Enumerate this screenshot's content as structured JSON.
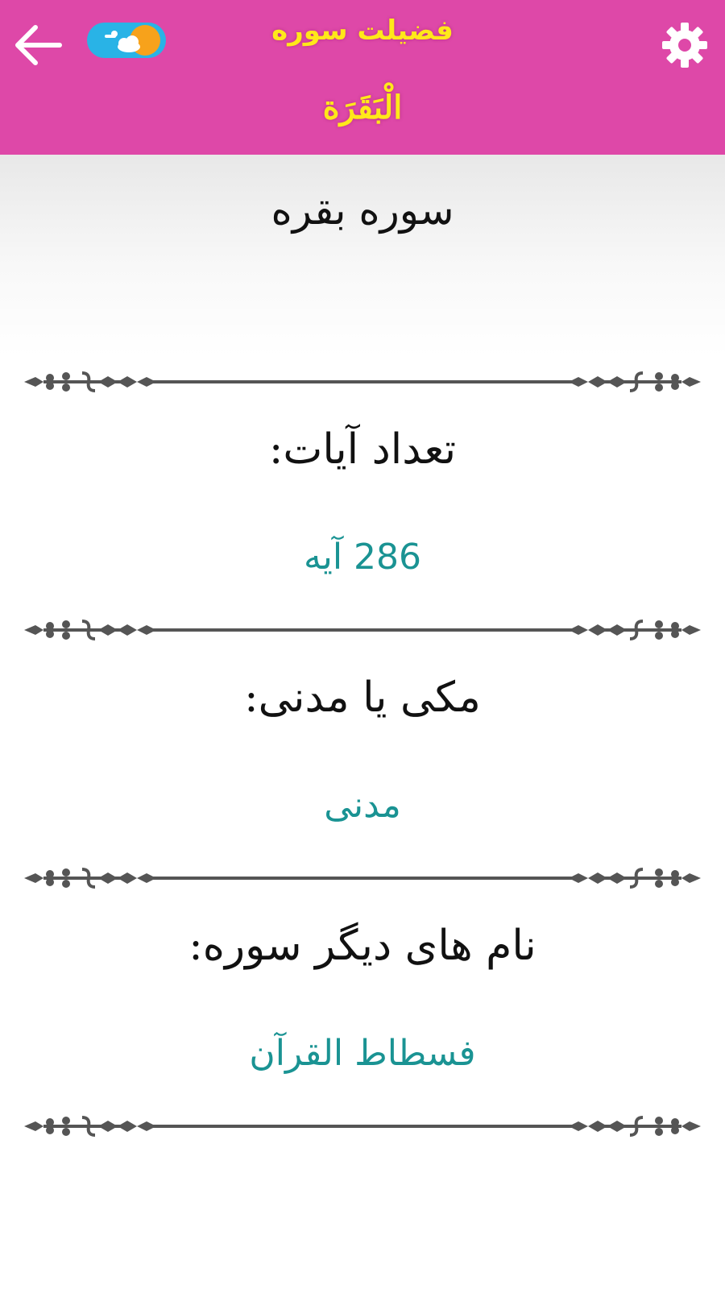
{
  "header": {
    "title": "فضیلت سوره",
    "surah_title": "الْبَقَرَة",
    "back_icon": "arrow-left-icon",
    "theme_toggle_icon": "day-night-toggle-icon",
    "settings_icon": "gear-icon"
  },
  "surah": {
    "name": "سوره بقره"
  },
  "info": {
    "verses_label": "تعداد آیات:",
    "verses_value": "286 آیه",
    "revelation_label": "مکی یا مدنی:",
    "revelation_value": "مدنی",
    "other_names_label": "نام های دیگر سوره:",
    "other_names_value": "فسطاط القرآن"
  },
  "colors": {
    "header_bg": "#de48a8",
    "title_color": "#ffe81a",
    "value_color": "#1a9393",
    "divider_color": "#555555",
    "toggle_sky": "#29b3e6",
    "toggle_sun": "#f7a21b"
  }
}
